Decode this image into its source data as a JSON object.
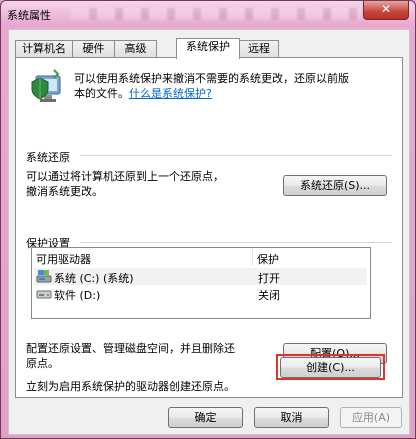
{
  "window": {
    "title": "系统属性",
    "close_label": "✕"
  },
  "tabs": [
    {
      "label": "计算机名",
      "active": false
    },
    {
      "label": "硬件",
      "active": false
    },
    {
      "label": "高级",
      "active": false
    },
    {
      "label": "系统保护",
      "active": true
    },
    {
      "label": "远程",
      "active": false
    }
  ],
  "intro": {
    "text_line1": "可以使用系统保护来撤消不需要的系统更改，还原以前版",
    "text_line2": "本的文件。",
    "link": "什么是系统保护?"
  },
  "restore": {
    "title": "系统还原",
    "desc_line1": "可以通过将计算机还原到上一个还原点，",
    "desc_line2": "撤消系统更改。",
    "button": "系统还原(S)..."
  },
  "protection": {
    "title": "保护设置",
    "columns": [
      "可用驱动器",
      "保护"
    ],
    "rows": [
      {
        "drive": "系统 (C:) (系统)",
        "status": "打开",
        "icon": "system-drive-icon"
      },
      {
        "drive": "软件 (D:)",
        "status": "关闭",
        "icon": "hard-drive-icon"
      }
    ],
    "config_desc_line1": "配置还原设置、管理磁盘空间，并且删除还",
    "config_desc_line2": "原点。",
    "config_button": "配置(O)...",
    "create_desc": "立刻为启用系统保护的驱动器创建还原点。",
    "create_button": "创建(C)..."
  },
  "footer": {
    "ok": "确定",
    "cancel": "取消",
    "apply": "应用(A)"
  },
  "colors": {
    "highlight": "#e0342a",
    "link": "#0066cc"
  }
}
